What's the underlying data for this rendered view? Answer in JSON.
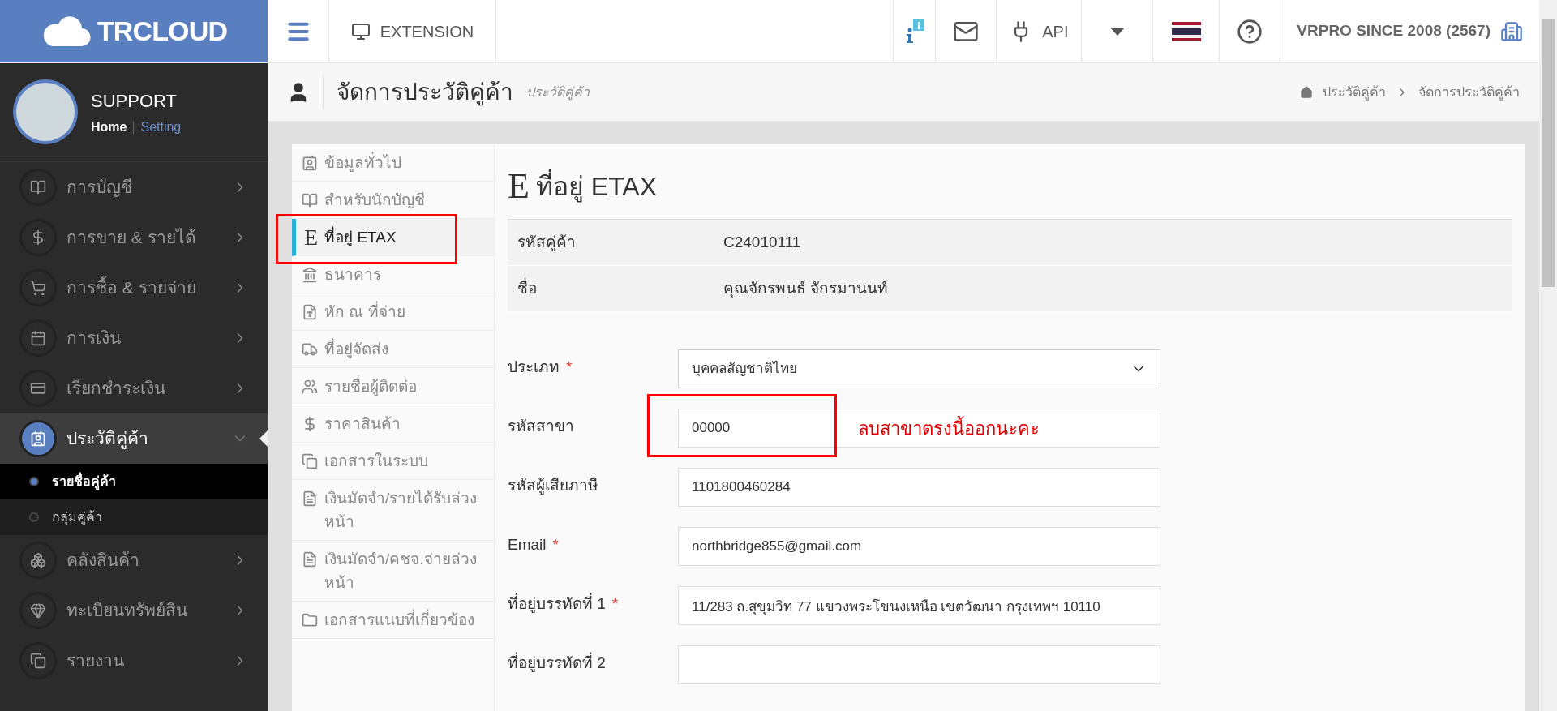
{
  "brand": {
    "logo_text": "TRCLOUD"
  },
  "topbar": {
    "extension": "EXTENSION",
    "api": "API",
    "company": "VRPRO SINCE 2008 (2567)"
  },
  "profile": {
    "name": "SUPPORT",
    "home_link": "Home",
    "setting_link": "Setting"
  },
  "sidebar": {
    "items": [
      {
        "label": "การบัญชี",
        "selected": false,
        "expanded": false
      },
      {
        "label": "การขาย & รายได้",
        "selected": false,
        "expanded": false
      },
      {
        "label": "การซื้อ & รายจ่าย",
        "selected": false,
        "expanded": false
      },
      {
        "label": "การเงิน",
        "selected": false,
        "expanded": false
      },
      {
        "label": "เรียกชำระเงิน",
        "selected": false,
        "expanded": false
      },
      {
        "label": "ประวัติคู่ค้า",
        "selected": true,
        "expanded": true,
        "children": [
          {
            "label": "รายชื่อคู่ค้า",
            "selected": true
          },
          {
            "label": "กลุ่มคู่ค้า",
            "selected": false
          }
        ]
      },
      {
        "label": "คลังสินค้า",
        "selected": false,
        "expanded": false
      },
      {
        "label": "ทะเบียนทรัพย์สิน",
        "selected": false,
        "expanded": false
      },
      {
        "label": "รายงาน",
        "selected": false,
        "expanded": false
      }
    ]
  },
  "page_header": {
    "title": "จัดการประวัติคู่ค้า",
    "subtitle": "ประวัติคู่ค้า",
    "breadcrumb": [
      "ประวัติคู่ค้า",
      "จัดการประวัติคู่ค้า"
    ]
  },
  "subnav": {
    "items": [
      {
        "label": "ข้อมูลทั่วไป",
        "selected": false,
        "highlighted": false
      },
      {
        "label": "สำหรับนักบัญชี",
        "selected": false,
        "highlighted": false
      },
      {
        "label": "ที่อยู่ ETAX",
        "glyph": "E",
        "selected": true,
        "highlighted": true
      },
      {
        "label": "ธนาคาร",
        "selected": false,
        "highlighted": false
      },
      {
        "label": "หัก ณ ที่จ่าย",
        "selected": false,
        "highlighted": false
      },
      {
        "label": "ที่อยู่จัดส่ง",
        "selected": false,
        "highlighted": false
      },
      {
        "label": "รายชื่อผู้ติดต่อ",
        "selected": false,
        "highlighted": false
      },
      {
        "label": "ราคาสินค้า",
        "selected": false,
        "highlighted": false
      },
      {
        "label": "เอกสารในระบบ",
        "selected": false,
        "highlighted": false
      },
      {
        "label": "เงินมัดจำ/รายได้รับล่วงหน้า",
        "selected": false,
        "highlighted": false
      },
      {
        "label": "เงินมัดจำ/คชจ.จ่ายล่วงหน้า",
        "selected": false,
        "highlighted": false
      },
      {
        "label": "เอกสารแนบที่เกี่ยวข้อง",
        "selected": false,
        "highlighted": false
      }
    ]
  },
  "section": {
    "glyph": "E",
    "title": "ที่อยู่ ETAX",
    "info": [
      {
        "label": "รหัสคู่ค้า",
        "value": "C24010111"
      },
      {
        "label": "ชื่อ",
        "value": "คุณจักรพนธ์ จักรมานนท์"
      }
    ],
    "fields": [
      {
        "label": "ประเภท",
        "required_mark": "*",
        "kind": "select",
        "value": "บุคคลสัญชาติไทย",
        "highlighted": false
      },
      {
        "label": "รหัสสาขา",
        "kind": "text",
        "value": "00000",
        "highlighted": true,
        "note": "ลบสาขาตรงนี้ออกนะคะ"
      },
      {
        "label": "รหัสผู้เสียภาษี",
        "kind": "text",
        "value": "1101800460284",
        "highlighted": false
      },
      {
        "label": "Email",
        "required_mark": "*",
        "kind": "text",
        "value": "northbridge855@gmail.com",
        "highlighted": false
      },
      {
        "label": "ที่อยู่บรรทัดที่ 1",
        "required_mark": "*",
        "kind": "text",
        "value": "11/283 ถ.สุขุมวิท 77 แขวงพระโขนงเหนือ เขตวัฒนา กรุงเทพฯ 10110",
        "highlighted": false
      },
      {
        "label": "ที่อยู่บรรทัดที่ 2",
        "kind": "text",
        "highlighted": false
      }
    ]
  }
}
